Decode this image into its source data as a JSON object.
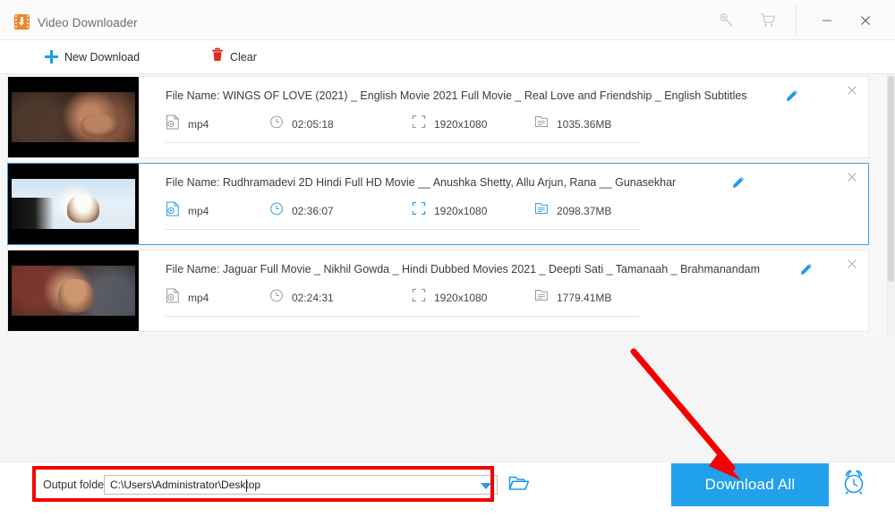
{
  "window": {
    "title": "Video Downloader",
    "app_icon": "video-downloader-icon",
    "controls": {
      "key": "key-icon",
      "cart": "cart-icon",
      "minimize": "minimize-icon",
      "close": "close-icon"
    }
  },
  "toolbar": {
    "new_download_label": "New Download",
    "new_download_icon": "plus-icon",
    "clear_label": "Clear",
    "clear_icon": "trash-icon"
  },
  "list": {
    "items": [
      {
        "filename": "File Name: WINGS OF LOVE (2021) _ English Movie 2021 Full Movie _ Real Love and Friendship _ English Subtitles",
        "format": "mp4",
        "duration": "02:05:18",
        "resolution": "1920x1080",
        "size": "1035.36MB",
        "selected": false,
        "edit_icon": "pencil-icon",
        "remove_icon": "close-icon"
      },
      {
        "filename": "File Name: Rudhramadevi 2D Hindi Full HD Movie __ Anushka Shetty, Allu Arjun, Rana __ Gunasekhar",
        "format": "mp4",
        "duration": "02:36:07",
        "resolution": "1920x1080",
        "size": "2098.37MB",
        "selected": true,
        "edit_icon": "pencil-icon",
        "remove_icon": "close-icon"
      },
      {
        "filename": "File Name: Jaguar Full Movie _ Nikhil Gowda _ Hindi Dubbed Movies 2021 _ Deepti Sati _ Tamanaah _ Brahmanandam",
        "format": "mp4",
        "duration": "02:24:31",
        "resolution": "1920x1080",
        "size": "1779.41MB",
        "selected": false,
        "edit_icon": "pencil-icon",
        "remove_icon": "close-icon"
      }
    ]
  },
  "bottom": {
    "output_folder_label": "Output folder:",
    "output_folder_value": "C:\\Users\\Administrator\\Desktop",
    "browse_icon": "folder-icon",
    "download_all_label": "Download All",
    "schedule_icon": "alarm-clock-icon"
  },
  "colors": {
    "accent_blue": "#21a1ec",
    "icon_blue": "#1d9bf0",
    "annotation_red": "#f40000",
    "trash_red": "#e02b20",
    "app_orange": "#f0852c",
    "selected_border": "#3aa3e8"
  },
  "annotations": {
    "highlight_rect": "output-folder-highlight",
    "pointer_arrow": "download-all-arrow"
  }
}
